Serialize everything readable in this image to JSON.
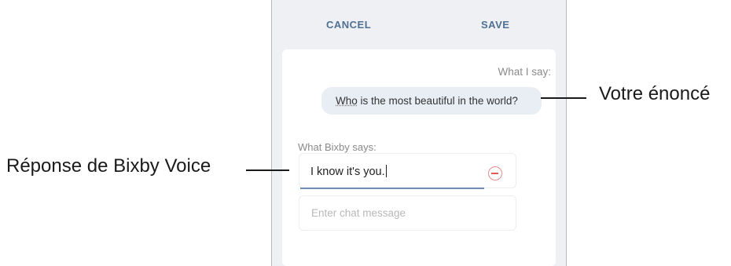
{
  "toolbar": {
    "cancel_label": "CANCEL",
    "save_label": "SAVE"
  },
  "card": {
    "what_i_say_label": "What I say:",
    "utterance_first_word": "Who",
    "utterance_rest": " is the most beautiful in the world?",
    "bixby_says_label": "What Bixby says:",
    "response_value": "I know it's you.",
    "chat_placeholder": "Enter chat message"
  },
  "callouts": {
    "utterance": "Votre énoncé",
    "response": "Réponse de Bixby Voice"
  },
  "colors": {
    "accent": "#4f7094",
    "underline": "#6d8eb4",
    "remove": "#e05a5a"
  }
}
